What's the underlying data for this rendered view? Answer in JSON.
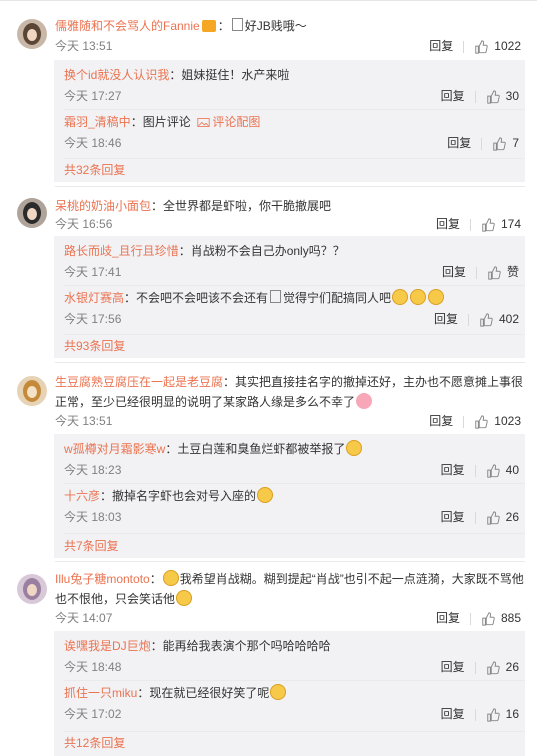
{
  "actions": {
    "reply": "回复"
  },
  "comments": [
    {
      "user": "儒雅随和不会骂人的Fannie",
      "text": "：",
      "text2": "好JB贱哦～",
      "time": "今天 13:51",
      "likes": "1022",
      "replies": [
        {
          "user": "换个id就没人认识我",
          "text": "：姐妹挺住！水产来啦",
          "time": "今天 17:27",
          "likes": "30"
        },
        {
          "user": "霜羽_清稿中",
          "text": "：图片评论",
          "link": "评论配图",
          "time": "今天 18:46",
          "likes": "7"
        }
      ],
      "more": "共32条回复"
    },
    {
      "user": "呆桃的奶油小面包",
      "text": "：全世界都是虾啦，你干脆撤展吧",
      "time": "今天 16:56",
      "likes": "174",
      "replies": [
        {
          "user": "路长而歧_且行且珍惜",
          "text": "：肖战粉不会自己办only吗？？",
          "time": "今天 17:41",
          "likes": "赞"
        },
        {
          "user": "水银灯赛高",
          "text": "：不会吧不会吧该不会还有",
          "text2": "觉得宁们配搞同人吧",
          "time": "今天 17:56",
          "likes": "402"
        }
      ],
      "more": "共93条回复"
    },
    {
      "user": "生豆腐熟豆腐压在一起是老豆腐",
      "text": "：其实把直接挂名字的撤掉还好，主办也不愿意摊上事很正常，至少已经很明显的说明了某家路人缘是多么不幸了",
      "time": "今天 13:51",
      "likes": "1023",
      "replies": [
        {
          "user": "w孤樽对月霜影寒w",
          "text": "：土豆白莲和臭鱼烂虾都被举报了",
          "time": "今天 18:23",
          "likes": "40"
        },
        {
          "user": "十六彦",
          "text": "：撤掉名字虾也会对号入座的",
          "time": "今天 18:03",
          "likes": "26"
        }
      ],
      "more": "共7条回复"
    },
    {
      "user": "Illu兔子糖montoto",
      "text": "：",
      "text2": "我希望肖战糊。糊到提起“肖战”也引不起一点涟漪，大家既不骂他也不恨他，只会笑话他",
      "time": "今天 14:07",
      "likes": "885",
      "replies": [
        {
          "user": "诶嘿我是DJ巨炮",
          "text": "：能再给我表演个那个吗哈哈哈哈",
          "time": "今天 18:48",
          "likes": "26"
        },
        {
          "user": "抓住一只miku",
          "text": "：现在就已经很好笑了呢",
          "time": "今天 17:02",
          "likes": "16"
        }
      ],
      "more": "共12条回复"
    }
  ]
}
